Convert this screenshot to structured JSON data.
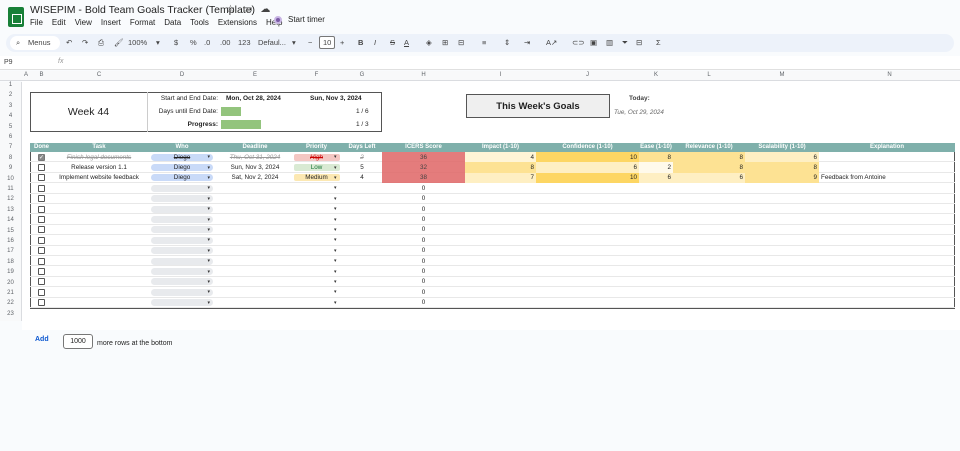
{
  "app": {
    "title": "WISEPIM - Bold Team Goals Tracker (Template)",
    "menu": [
      "File",
      "Edit",
      "View",
      "Insert",
      "Format",
      "Data",
      "Tools",
      "Extensions",
      "Help"
    ],
    "timer_label": "Start timer"
  },
  "toolbar": {
    "search_label": "Menus",
    "zoom": "100%",
    "currency": "$",
    "percent": "%",
    "dec_decrease": ".0",
    "dec_increase": ".00",
    "number_format": "123",
    "font": "Defaul...",
    "font_size": "10",
    "minus": "−",
    "plus": "+"
  },
  "formula_bar": {
    "cell_ref": "P9",
    "fx": "fx"
  },
  "columns": [
    "A",
    "B",
    "C",
    "D",
    "E",
    "F",
    "G",
    "H",
    "I",
    "J",
    "K",
    "L",
    "M",
    "N"
  ],
  "row_numbers": [
    "1",
    "2",
    "3",
    "4",
    "5",
    "6",
    "7",
    "8",
    "9",
    "10",
    "11",
    "12",
    "13",
    "14",
    "15",
    "16",
    "17",
    "18",
    "19",
    "20",
    "21",
    "22",
    "23"
  ],
  "info": {
    "week": "Week 44",
    "start_end_label": "Start and End Date:",
    "start_date": "Mon, Oct 28, 2024",
    "end_date": "Sun, Nov 3, 2024",
    "days_until_label": "Days until End Date:",
    "days_fraction": "1 / 6",
    "days_progress": 0.17,
    "progress_label": "Progress:",
    "progress_fraction": "1 / 3",
    "progress_value": 0.33
  },
  "goals_title": "This Week's Goals",
  "today_label": "Today:",
  "today_value": "Tue, Oct 29, 2024",
  "table": {
    "headers": [
      "Done",
      "Task",
      "Who",
      "Deadline",
      "Priority",
      "Days Left",
      "ICERS Score",
      "Impact (1-10)",
      "Confidence (1-10)",
      "Ease (1-10)",
      "Relevance (1-10)",
      "Scalability (1-10)",
      "Explanation"
    ],
    "rows": [
      {
        "done": true,
        "task": "Finish legal documents",
        "who": "Diego",
        "deadline": "Thu, Oct 31, 2024",
        "priority": "High",
        "days_left": "2",
        "icers": "36",
        "impact": "4",
        "confidence": "10",
        "ease": "8",
        "relevance": "8",
        "scalability": "6",
        "explanation": ""
      },
      {
        "done": false,
        "task": "Release version 1.1",
        "who": "Diego",
        "deadline": "Sun, Nov 3, 2024",
        "priority": "Low",
        "days_left": "5",
        "icers": "32",
        "impact": "8",
        "confidence": "6",
        "ease": "2",
        "relevance": "8",
        "scalability": "8",
        "explanation": ""
      },
      {
        "done": false,
        "task": "Implement website feedback",
        "who": "Diego",
        "deadline": "Sat, Nov 2, 2024",
        "priority": "Medium",
        "days_left": "4",
        "icers": "38",
        "impact": "7",
        "confidence": "10",
        "ease": "6",
        "relevance": "6",
        "scalability": "9",
        "explanation": "Feedback from Antoine"
      }
    ],
    "empty_rows": 12,
    "empty_icers": "0"
  },
  "footer": {
    "add_label": "Add",
    "rows_value": "1000",
    "more_rows_label": "more rows at the bottom"
  },
  "colors": {
    "header_teal": "#7fb0ab",
    "high": "#f4c7c3",
    "low": "#d9ead3",
    "medium": "#fce8b2",
    "who_chip": "#c9daf8",
    "icers": "#e06666"
  }
}
